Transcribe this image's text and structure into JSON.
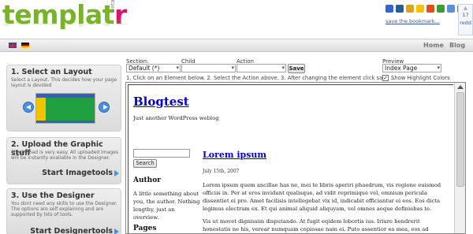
{
  "header": {
    "logo_main": "templat",
    "logo_r": "r",
    "logo_beta": "beta",
    "bookmark_link": "save the bookmark...",
    "reddit_count": "17",
    "reddit_label": "redd"
  },
  "social_icons": [
    {
      "name": "delicious-icon",
      "color": "#3366cc"
    },
    {
      "name": "digg-icon",
      "color": "#2a5d95"
    },
    {
      "name": "magnolia-icon",
      "color": "#e0a020"
    },
    {
      "name": "star-icon",
      "color": "#f5c400"
    },
    {
      "name": "stumbleupon-icon",
      "color": "#e94b1a"
    },
    {
      "name": "technorati-icon",
      "color": "#36a036"
    },
    {
      "name": "furl-icon",
      "color": "#5b8fd6"
    },
    {
      "name": "mail-icon",
      "color": "#7a7a7a"
    }
  ],
  "nav": {
    "home": "Home",
    "blog": "Blog"
  },
  "steps": [
    {
      "title": "1. Select an Layout",
      "desc": "Select a Layout. This decides how your page layout is devided"
    },
    {
      "title": "2. Upload the Graphic stuff",
      "desc": "The Upload is very easy. All uploaded Images will be instantly available in the Designer.",
      "button": "Start Imagetools"
    },
    {
      "title": "3. Use the Designer",
      "desc": "You dont need any skills to use the Designer. The options are self explaining and are supported by lots of tools.",
      "button": "Start Designertools"
    }
  ],
  "controls": {
    "section_label": "Section:",
    "section_value": "Default (*)",
    "child_label": "Child",
    "child_value": "",
    "action_label": "Action",
    "action_value": "",
    "save_label": "Save",
    "preview_label": "Preview",
    "preview_value": "Index Page",
    "instructions": "1. Click on an Element below. 2. Select the Action above. 3. After changing the element click save ...",
    "highlight_label": "Show Highlight Colors",
    "highlight_checked": "✓"
  },
  "preview": {
    "blog_title": "Blogtest",
    "tagline": "Just another WordPress weblog",
    "search_button": "Search",
    "author_heading": "Author",
    "author_text": "A little something about you, the author. Nothing lengthy, just an overview.",
    "pages_heading": "Pages",
    "post_title": "Lorem ipsum",
    "post_date": "July 15th, 2007",
    "post_p1": "Lorem ipsum quem ancillae has ne, mei te libris aperiri phaedrum, vis regione euismod officiis in. Per at eros invidunt qualisque, ad vidit reprimique vel, omnium pericula dissentiet ei pro. Amet facilisis intellegebat vix id, indicabit efficiantur ei eos. Eos dicta legimus electram ex. Et qui animal aliquid aliquyam, vel omnes aeque definiebas te.",
    "post_p2": "Vis ut movet dignissim disputando. At fugit eqidem lobortis ius. Iriure hendrerit honestatis ne his, verear numquam copiosae nam ei. Puto assentior ea mea, eos ad alienum lucilius. Per in diam"
  }
}
